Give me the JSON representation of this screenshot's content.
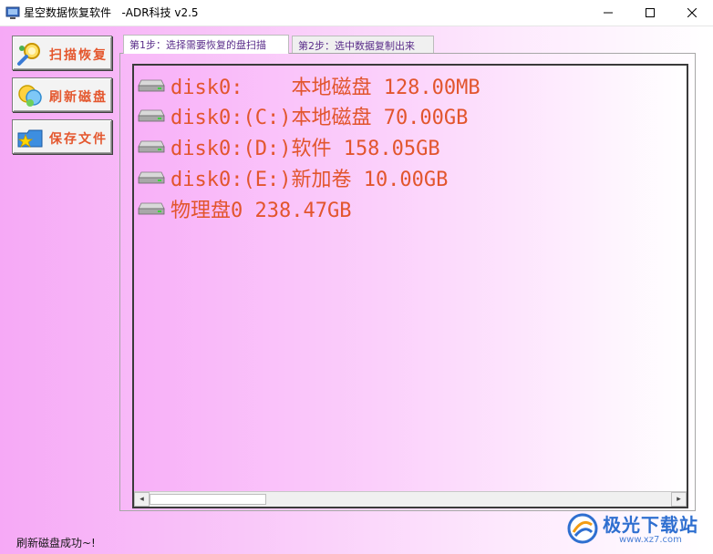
{
  "window": {
    "title": "星空数据恢复软件   -ADR科技 v2.5",
    "controls": {
      "minimize": "—",
      "maximize": "☐",
      "close": "✕"
    }
  },
  "sidebar": {
    "buttons": [
      {
        "label": "扫描恢复",
        "icon": "magnifier-icon"
      },
      {
        "label": "刷新磁盘",
        "icon": "refresh-disk-icon"
      },
      {
        "label": "保存文件",
        "icon": "save-folder-icon"
      }
    ]
  },
  "tabs": [
    {
      "label": "第1步：选择需要恢复的盘扫描",
      "active": true
    },
    {
      "label": "第2步：选中数据复制出来",
      "active": false
    }
  ],
  "disk_list": [
    {
      "text": "disk0:    本地磁盘 128.00MB",
      "icon": "disk-drive-icon"
    },
    {
      "text": "disk0:(C:)本地磁盘 70.00GB",
      "icon": "disk-drive-icon"
    },
    {
      "text": "disk0:(D:)软件 158.05GB",
      "icon": "disk-drive-icon"
    },
    {
      "text": "disk0:(E:)新加卷 10.00GB",
      "icon": "disk-drive-icon"
    },
    {
      "text": "物理盘0 238.47GB",
      "icon": "disk-drive-icon"
    }
  ],
  "scrollbar": {
    "left_arrow": "◂",
    "right_arrow": "▸",
    "position": 0.0
  },
  "status": {
    "text": "刷新磁盘成功~!"
  },
  "watermark": {
    "brand": "极光下载站",
    "url": "www.xz7.com"
  },
  "colors": {
    "item_text": "#e2552d",
    "button_label": "#e4572e",
    "tab_text": "#5a2d8a",
    "background_pink": "#f6a9f6"
  }
}
